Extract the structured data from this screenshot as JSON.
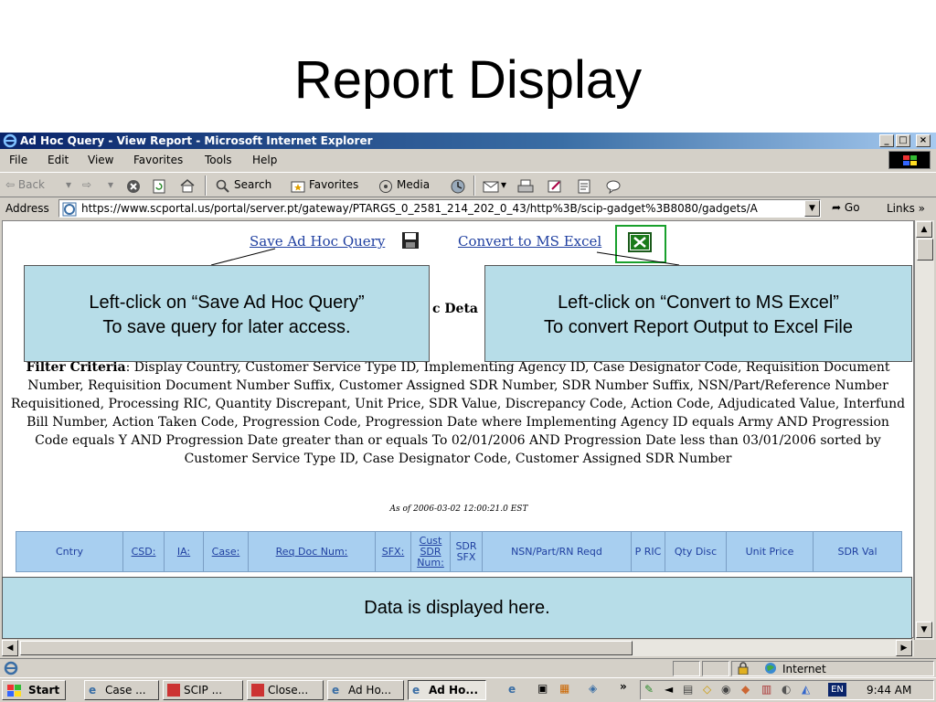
{
  "slide": {
    "title": "Report Display"
  },
  "window": {
    "title": "Ad Hoc Query - View Report - Microsoft Internet Explorer",
    "minimize": "_",
    "maximize": "□",
    "close": "×"
  },
  "menu": [
    "File",
    "Edit",
    "View",
    "Favorites",
    "Tools",
    "Help"
  ],
  "toolbar": {
    "back": "⇦ Back",
    "forward": "⇨",
    "search": "Search",
    "favorites": "Favorites",
    "media": "Media"
  },
  "address": {
    "label": "Address",
    "url": "https://www.scportal.us/portal/server.pt/gateway/PTARGS_0_2581_214_202_0_43/http%3B/scip-gadget%3B8080/gadgets/A",
    "go": "Go",
    "links": "Links »"
  },
  "report": {
    "save_link": "Save Ad Hoc Query",
    "excel_link": "Convert to MS Excel",
    "title_fragment": "c Deta",
    "filter_label": "Filter Criteria",
    "filter_text": ": Display Country, Customer Service Type ID, Implementing Agency ID, Case Designator Code, Requisition Document Number, Requisition Document Number Suffix, Customer Assigned SDR Number, SDR Number Suffix, NSN/Part/Reference Number Requisitioned, Processing RIC, Quantity Discrepant, Unit Price, SDR Value, Discrepancy Code, Action Code, Adjudicated Value, Interfund Bill Number, Action Taken Code, Progression Code, Progression Date where Implementing Agency ID equals Army AND Progression Code equals Y AND Progression Date greater than or equals To 02/01/2006 AND Progression Date less than 03/01/2006 sorted by Customer Service Type ID, Case Designator Code, Customer Assigned SDR Number",
    "as_of": "As of 2006-03-02 12:00:21.0 EST"
  },
  "table_headers": [
    "Cntry",
    "CSD:",
    "IA:",
    "Case:",
    "Req Doc Num:",
    "SFX:",
    "Cust SDR Num:",
    "SDR SFX",
    "NSN/Part/RN Reqd",
    "P RIC",
    "Qty Disc",
    "Unit Price",
    "SDR Val"
  ],
  "status": {
    "zone": "Internet"
  },
  "taskbar": {
    "start": "Start",
    "tasks": [
      "Case ...",
      "SCIP ...",
      "Close...",
      "Ad Ho...",
      "Ad Ho..."
    ],
    "lang": "EN",
    "clock": "9:44 AM"
  },
  "callouts": {
    "save_line1": "Left-click on “Save Ad Hoc Query”",
    "save_line2": "To save query for later access.",
    "excel_line1": "Left-click on “Convert to MS Excel”",
    "excel_line2": "To convert Report Output to Excel File",
    "data": "Data is displayed here."
  },
  "colors": {
    "titlebar": "#0a246a",
    "callout_fill": "#b7dde8",
    "table_header": "#a8cff0",
    "link": "#1f3fa0",
    "excel_highlight": "#18a02c"
  }
}
